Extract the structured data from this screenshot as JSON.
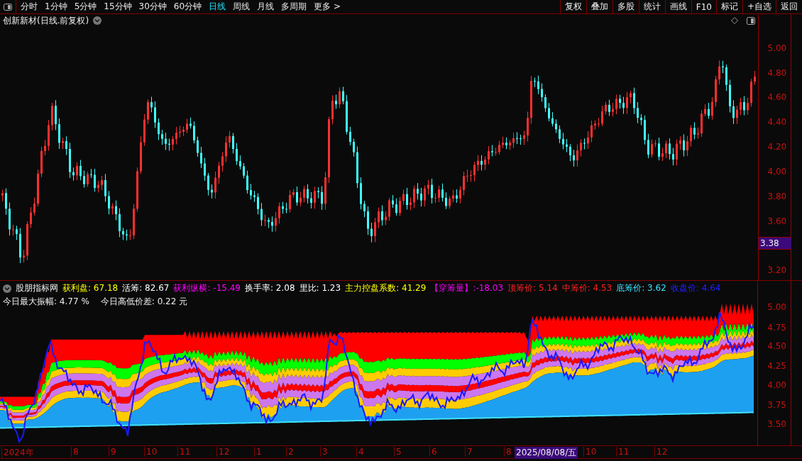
{
  "toolbar": {
    "periods": [
      {
        "label": "分时",
        "selected": false
      },
      {
        "label": "1分钟",
        "selected": false
      },
      {
        "label": "5分钟",
        "selected": false
      },
      {
        "label": "15分钟",
        "selected": false
      },
      {
        "label": "30分钟",
        "selected": false
      },
      {
        "label": "60分钟",
        "selected": false
      },
      {
        "label": "日线",
        "selected": true
      },
      {
        "label": "周线",
        "selected": false
      },
      {
        "label": "月线",
        "selected": false
      },
      {
        "label": "多周期",
        "selected": false
      },
      {
        "label": "更多 >",
        "selected": false
      }
    ],
    "actions": [
      "复权",
      "叠加",
      "多股",
      "统计",
      "画线",
      "F10",
      "标记",
      "+自选",
      "返回"
    ]
  },
  "main_chart": {
    "title": "创新新材(日线.前复权)",
    "y_axis": [
      "5.00",
      "4.80",
      "4.60",
      "4.40",
      "4.20",
      "4.00",
      "3.80",
      "3.60",
      "3.20"
    ],
    "price_tag": "3.38"
  },
  "indicator": {
    "name": "股朋指标网",
    "fields": [
      {
        "text": "获利盘: 67.18",
        "color": "#ffff00"
      },
      {
        "text": "活筹: 82.67",
        "color": "#ffffff"
      },
      {
        "text": "获利纵横: -15.49",
        "color": "#ff00ff"
      },
      {
        "text": "换手率: 2.08",
        "color": "#ffffff"
      },
      {
        "text": "里比: 1.23",
        "color": "#ffffff"
      },
      {
        "text": "主力控盘系数: 41.29",
        "color": "#ffff00"
      },
      {
        "text": "【穿筹量】:-18.03",
        "color": "#ff00ff"
      },
      {
        "text": "顶筹价: 5.14",
        "color": "#ff2020"
      },
      {
        "text": "中筹价: 4.53",
        "color": "#ff2020"
      },
      {
        "text": "底筹价: 3.62",
        "color": "#40e0ff"
      },
      {
        "text": "收盘价: 4.64",
        "color": "#2020ff"
      }
    ],
    "line2": [
      "今日最大振幅: 4.77 %",
      "今日高低价差: 0.22 元"
    ],
    "y_axis": [
      "5.00",
      "4.75",
      "4.50",
      "4.25",
      "4.00",
      "3.75",
      "3.50"
    ]
  },
  "time_axis": {
    "labels": [
      "2024年",
      "8",
      "9",
      "10",
      "11",
      "12",
      "1",
      "2",
      "3",
      "4",
      "5",
      "6",
      "7",
      "8"
    ],
    "after_cursor": [
      "10",
      "11",
      "12"
    ],
    "cursor_date": "2025/08/08/五"
  }
}
